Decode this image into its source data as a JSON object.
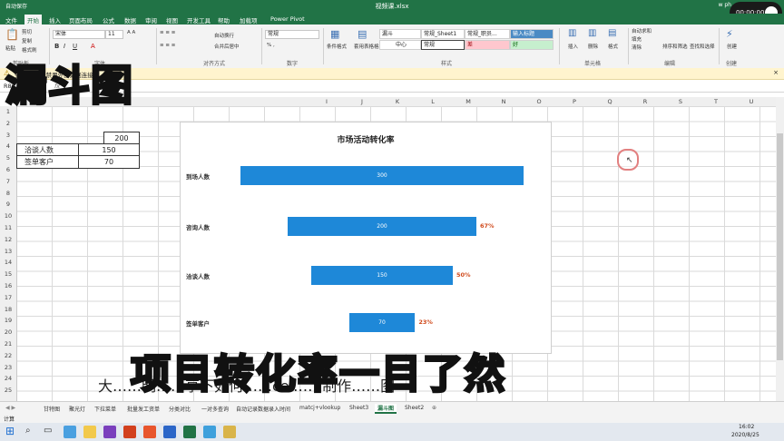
{
  "window": {
    "title": "视频课.xlsx",
    "autosave": "自动保存",
    "user": "w ph"
  },
  "recorder": {
    "time": "00:00:00"
  },
  "ribbon_tabs": [
    "文件",
    "开始",
    "插入",
    "页面布局",
    "公式",
    "数据",
    "审阅",
    "视图",
    "开发工具",
    "帮助",
    "加载项",
    "帮助",
    "Power Pivot"
  ],
  "ribbon": {
    "paste": "粘贴",
    "cut": "剪切",
    "copy": "复制",
    "format_painter": "格式刷",
    "clipboard_label": "剪贴板",
    "font_label": "字体",
    "align_label": "对齐方式",
    "number_label": "数字",
    "styles_label": "样式",
    "cells_label": "单元格",
    "edit_label": "编辑",
    "create_label": "创建",
    "font_name": "宋体",
    "font_size": "11",
    "wrap": "自动换行",
    "merge": "合并后居中",
    "number_format": "常规",
    "cond_format": "条件格式",
    "table_format": "套用表格格式",
    "styles": [
      "漏斗",
      "常规_Sheet1",
      "常规_职员...",
      "输入标题",
      "中心",
      "常规",
      "差",
      "好"
    ],
    "insert": "插入",
    "delete": "删除",
    "format": "格式",
    "autosum": "自动求和",
    "fill": "填充",
    "clear": "清除",
    "sort": "排序和筛选",
    "find": "查找和选择",
    "create": "创建"
  },
  "infobar": {
    "text": "安全警告 已禁用外部数据连接"
  },
  "formula": {
    "namebox": "R8",
    "fx": "fx"
  },
  "columns": [
    "",
    "",
    "",
    "",
    "",
    "",
    "",
    "I",
    "J",
    "K",
    "L",
    "M",
    "N",
    "O",
    "P",
    "Q",
    "R",
    "S",
    "T",
    "U",
    "V"
  ],
  "rows": [
    "1",
    "2",
    "3",
    "4",
    "5",
    "6",
    "7",
    "8",
    "9",
    "10",
    "11",
    "12",
    "13",
    "14",
    "15",
    "16",
    "17",
    "18",
    "19",
    "20",
    "21",
    "22",
    "23",
    "24",
    "25"
  ],
  "cells": [
    {
      "label": "洽谈人数",
      "value": "150"
    },
    {
      "label": "签单客户",
      "value": "70"
    }
  ],
  "cell_partial": "200",
  "chart_data": {
    "type": "bar",
    "title": "市场活动转化率",
    "categories": [
      "到场人数",
      "咨询人数",
      "洽谈人数",
      "签单客户"
    ],
    "values": [
      300,
      200,
      150,
      70
    ],
    "data_labels": [
      "300",
      "200",
      "150",
      "70"
    ],
    "conversion_labels": [
      "",
      "67%",
      "50%",
      "23%"
    ],
    "orientation": "horizontal-funnel",
    "colors": {
      "bar": "#1e88d8",
      "conversion": "#d04a1c"
    }
  },
  "sheet_tabs": [
    "甘特图",
    "聚光灯",
    "下拉菜单",
    "批量发工资单",
    "分类对比",
    "一对多查询",
    "自动记录数据录入时间",
    "matcj+vlookup",
    "Sheet3",
    "漏斗图",
    "Sheet2"
  ],
  "active_sheet": "漏斗图",
  "status": {
    "ready": "计算"
  },
  "taskbar": {
    "time": "16:02",
    "date": "2020/8/25"
  },
  "overlay": {
    "title": "漏斗图",
    "bottom": "项目转化率一目了然",
    "subtitle": "大……明……享下如何……cel……制作……图"
  }
}
